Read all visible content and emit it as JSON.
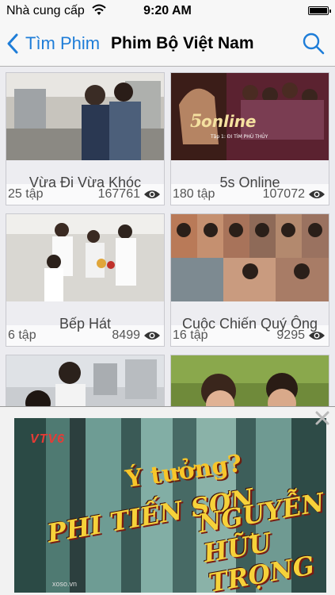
{
  "status_bar": {
    "carrier": "Nhà cung cấp",
    "time": "9:20 AM",
    "battery_level": 1.0,
    "wifi_icon": "wifi-icon"
  },
  "nav": {
    "back_label": "Tìm Phim",
    "title": "Phim Bộ Việt Nam",
    "search_icon": "search-icon",
    "accent_color": "#1e7dd8"
  },
  "cards": [
    {
      "episodes": "25 tập",
      "views": "167761",
      "title": "Vừa Đi Vừa Khóc",
      "thumb_logo": "",
      "thumb_caption": ""
    },
    {
      "episodes": "180 tập",
      "views": "107072",
      "title": "5s Online",
      "thumb_logo": "online",
      "thumb_caption": "Tập 1: ĐI TÌM PHÙ THỦY"
    },
    {
      "episodes": "6 tập",
      "views": "8499",
      "title": "Bếp Hát",
      "thumb_logo": "",
      "thumb_caption": ""
    },
    {
      "episodes": "16 tập",
      "views": "9295",
      "title": "Cuộc Chiến Quý Ông",
      "thumb_logo": "",
      "thumb_caption": ""
    },
    {
      "episodes": "",
      "views": "",
      "title": "",
      "thumb_logo": "",
      "thumb_caption": ""
    },
    {
      "episodes": "",
      "views": "",
      "title": "",
      "thumb_logo": "",
      "thumb_caption": ""
    }
  ],
  "ad": {
    "channel_logo": "VTV6",
    "show_title": "Ý tưởng?",
    "name_left": "PHI TIẾN SƠN",
    "name_right": "NGUYỄN HỮU TRỌNG",
    "small_text": "xoso.vn",
    "close_icon": "close-icon"
  }
}
